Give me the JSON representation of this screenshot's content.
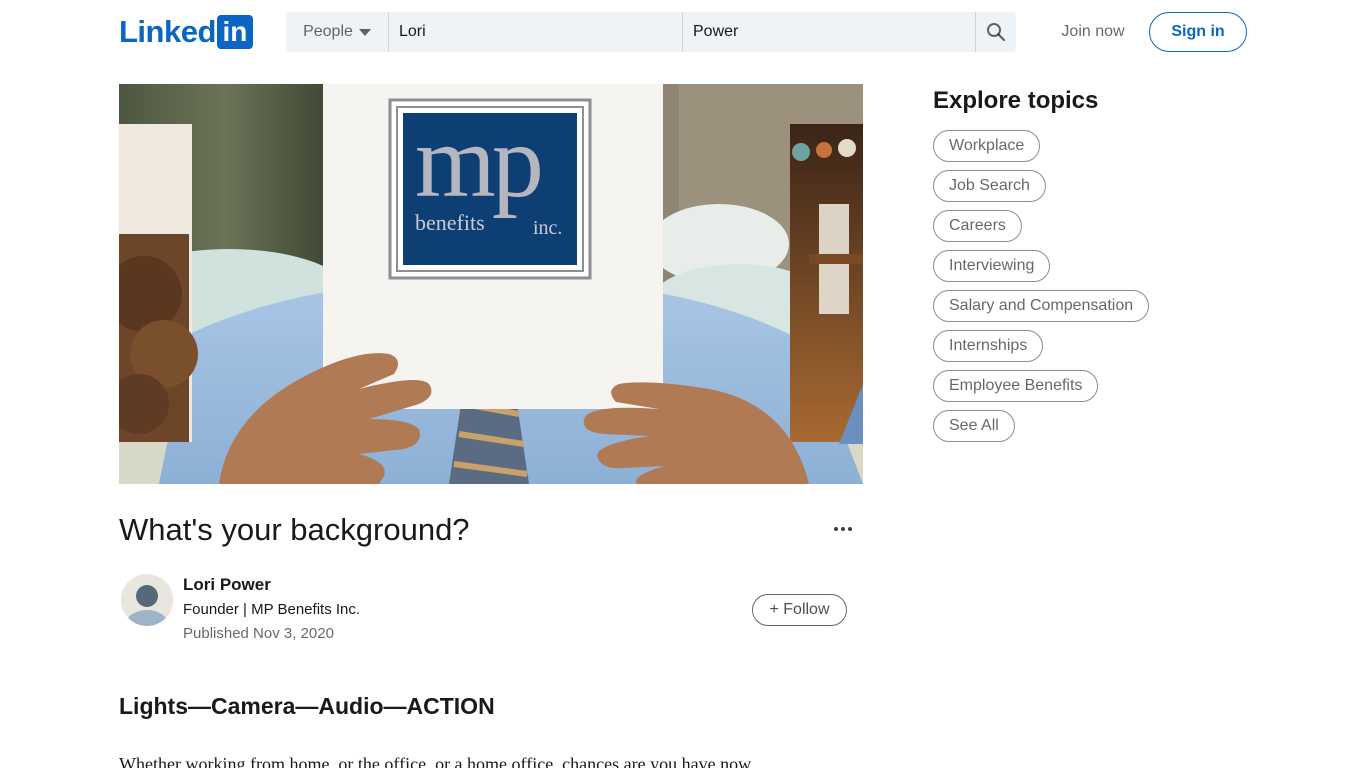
{
  "header": {
    "logo_text": "Linked",
    "logo_badge": "in",
    "search": {
      "type_label": "People",
      "first_name": "Lori",
      "last_name": "Power"
    },
    "join_label": "Join now",
    "signin_label": "Sign in"
  },
  "hero": {
    "logo_letters": "mp",
    "logo_word": "benefits",
    "logo_suffix": "inc."
  },
  "article": {
    "title": "What's your background?",
    "author": {
      "name": "Lori Power",
      "headline": "Founder | MP Benefits Inc.",
      "published": "Published Nov 3, 2020"
    },
    "follow_label": "+ Follow",
    "subheading": "Lights—Camera—Audio—ACTION",
    "body_first_line": "Whether working from home, or the office, or a home office, chances are you have now"
  },
  "explore": {
    "title": "Explore topics",
    "topics": [
      "Workplace",
      "Job Search",
      "Careers",
      "Interviewing",
      "Salary and Compensation",
      "Internships",
      "Employee Benefits",
      "See All"
    ]
  },
  "icons": {
    "search": "search-icon",
    "caret": "caret-down-icon",
    "more": "ellipsis-icon",
    "avatar": "default-avatar-icon"
  },
  "colors": {
    "brand": "#0a66c2",
    "search_bg": "#eef3f8",
    "hero_logo_bg": "#0e3f74"
  }
}
